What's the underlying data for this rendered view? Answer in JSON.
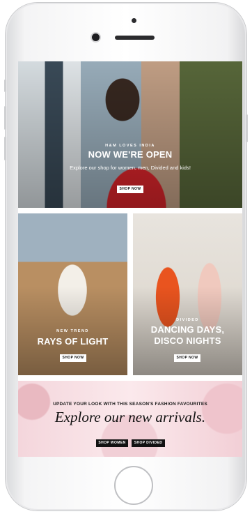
{
  "hero": {
    "kicker": "H&M LOVES INDIA",
    "headline": "NOW WE'RE OPEN",
    "subtext": "Explore our shop for women, men, Divided and kids!",
    "button": "SHOP NOW"
  },
  "tile_left": {
    "kicker": "NEW TREND",
    "headline": "RAYS OF LIGHT",
    "button": "SHOP NOW"
  },
  "tile_right": {
    "kicker": "DIVIDED",
    "headline_line1": "DANCING DAYS,",
    "headline_line2": "DISCO NIGHTS",
    "button": "SHOP NOW"
  },
  "banner": {
    "kicker": "UPDATE YOUR LOOK WITH THIS SEASON'S FASHION FAVOURITES",
    "title": "Explore our new arrivals.",
    "button_women": "SHOP WOMEN",
    "button_divided": "SHOP DIVIDED"
  }
}
